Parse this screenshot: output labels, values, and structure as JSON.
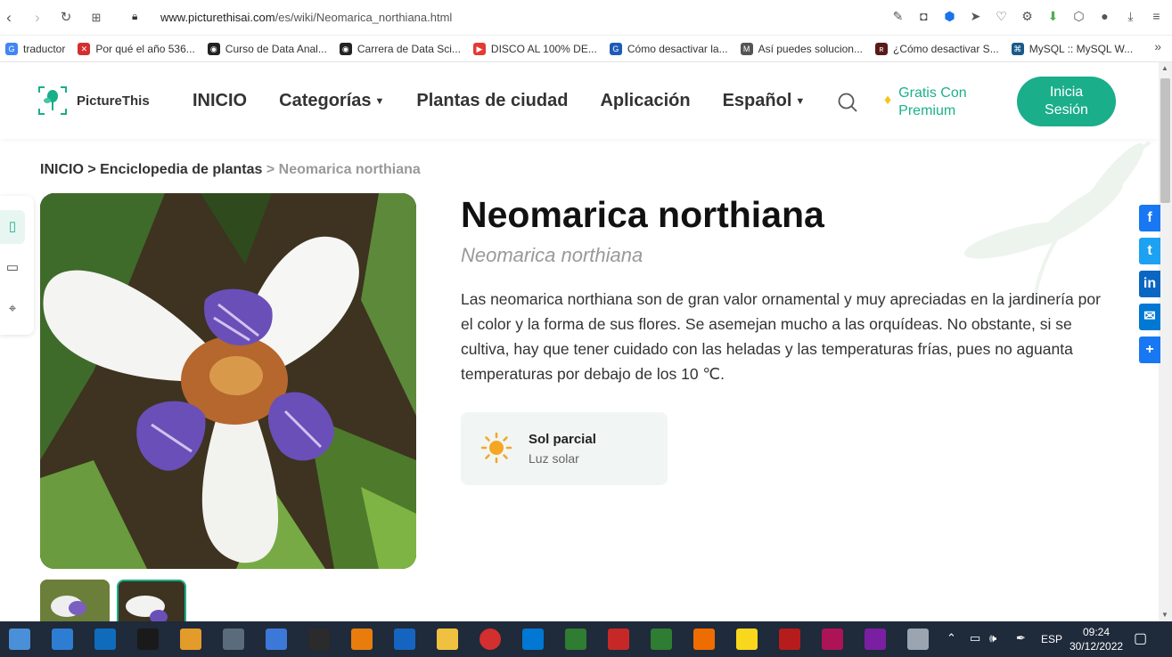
{
  "browser": {
    "url_domain": "www.picturethisai.com",
    "url_path": "/es/wiki/Neomarica_northiana.html"
  },
  "bookmarks": [
    {
      "label": "traductor",
      "color": "#4285f4",
      "glyph": "G"
    },
    {
      "label": "Por qué el año 536...",
      "color": "#d32f2f",
      "glyph": "✕"
    },
    {
      "label": "Curso de Data Anal...",
      "color": "#222222",
      "glyph": "◉"
    },
    {
      "label": "Carrera de Data Sci...",
      "color": "#222222",
      "glyph": "◉"
    },
    {
      "label": "DISCO AL 100% DE...",
      "color": "#e53935",
      "glyph": "▶"
    },
    {
      "label": "Cómo desactivar la...",
      "color": "#1e5bb8",
      "glyph": "G"
    },
    {
      "label": "Así puedes solucion...",
      "color": "#555555",
      "glyph": "M"
    },
    {
      "label": "¿Cómo desactivar S...",
      "color": "#5b1a1a",
      "glyph": "ʀ"
    },
    {
      "label": "MySQL :: MySQL W...",
      "color": "#1a5a8a",
      "glyph": "⌘"
    }
  ],
  "header": {
    "logo_text": "PictureThis",
    "nav": [
      "INICIO",
      "Categorías",
      "Plantas de ciudad",
      "Aplicación",
      "Español"
    ],
    "premium_line1": "Gratis Con",
    "premium_line2": "Premium",
    "login_line1": "Inicia",
    "login_line2": "Sesión"
  },
  "breadcrumb": {
    "home": "INICIO",
    "sep1": " > ",
    "section": "Enciclopedia de plantas",
    "sep2": " > ",
    "current": "Neomarica northiana"
  },
  "plant": {
    "name": "Neomarica northiana",
    "scientific": "Neomarica northiana",
    "description": "Las neomarica northiana son de gran valor ornamental y muy apreciadas en la jardinería por el color y la forma de sus flores. Se asemejan mucho a las orquídeas. No obstante, si se cultiva, hay que tener cuidado con las heladas y las temperaturas frías, pues no aguanta temperaturas por debajo de los 10 ℃.",
    "care": {
      "label": "Sol parcial",
      "sub": "Luz solar"
    }
  },
  "share": [
    {
      "name": "facebook",
      "glyph": "f",
      "color": "#1877f2"
    },
    {
      "name": "twitter",
      "glyph": "t",
      "color": "#1da1f2"
    },
    {
      "name": "linkedin",
      "glyph": "in",
      "color": "#0a66c2"
    },
    {
      "name": "email",
      "glyph": "✉",
      "color": "#0078d4"
    },
    {
      "name": "share",
      "glyph": "+",
      "color": "#1877f2"
    }
  ],
  "taskbar": {
    "lang": "ESP",
    "time": "09:24",
    "date": "30/12/2022"
  }
}
